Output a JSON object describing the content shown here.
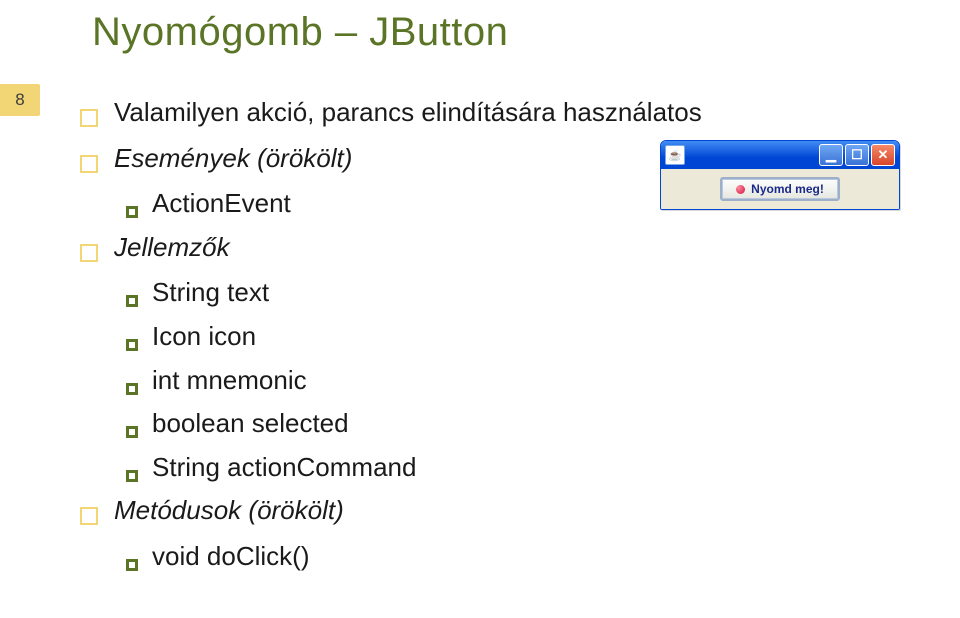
{
  "slide": {
    "title": "Nyomógomb – JButton",
    "page_number": "8"
  },
  "bullets": {
    "b1": "Valamilyen akció, parancs elindítására használatos",
    "b2": "Események (örökölt)",
    "b2_1": "ActionEvent",
    "b3": "Jellemzők",
    "b3_1": "String text",
    "b3_2": "Icon icon",
    "b3_3": "int mnemonic",
    "b3_4": "boolean selected",
    "b3_5": "String actionCommand",
    "b4": "Metódusok (örökölt)",
    "b4_1": "void doClick()"
  },
  "example": {
    "button_label": "Nyomd meg!",
    "min_glyph": "▁",
    "max_glyph": "☐",
    "close_glyph": "✕",
    "cup_glyph": "☕"
  }
}
